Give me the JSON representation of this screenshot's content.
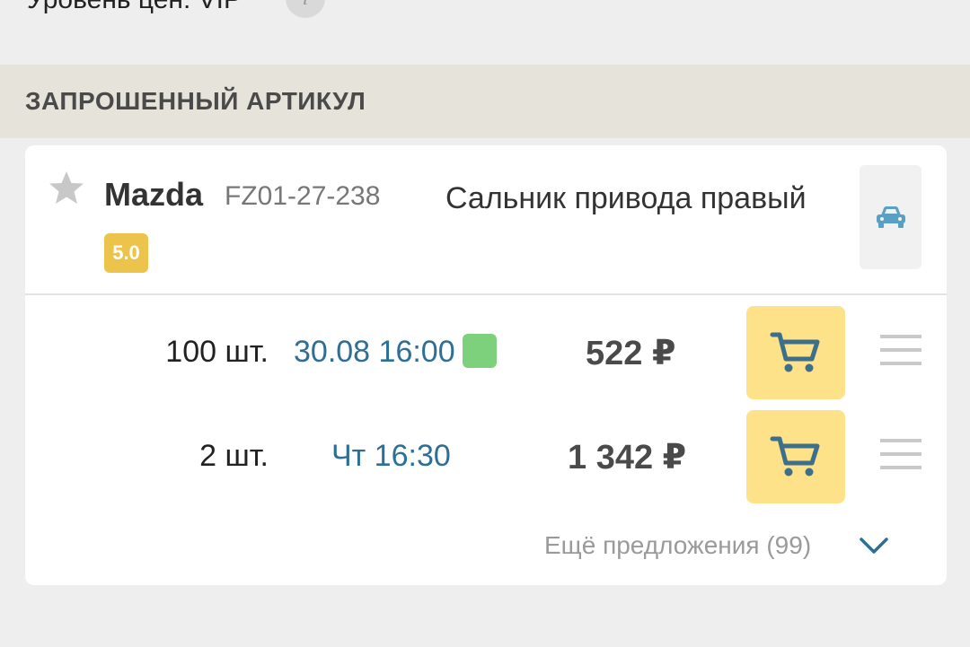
{
  "top": {
    "price_level_text": "Уровень цен: VIP",
    "info_icon": "info-icon",
    "info_glyph": "i"
  },
  "section": {
    "title": "ЗАПРОШЕННЫЙ АРТИКУЛ"
  },
  "product": {
    "brand": "Mazda",
    "article": "FZ01-27-238",
    "rating": "5.0",
    "description": "Сальник привода правый",
    "favorite_icon": "star-icon",
    "vehicle_icon": "car-icon"
  },
  "offers": [
    {
      "quantity": "100 шт.",
      "delivery": "30.08 16:00",
      "price": "522 ₽",
      "status_color": "#7dd07c",
      "cart_icon": "cart-icon",
      "menu_icon": "menu-icon"
    },
    {
      "quantity": "2 шт.",
      "delivery": "Чт 16:30",
      "price": "1 342 ₽",
      "cart_icon": "cart-icon",
      "menu_icon": "menu-icon"
    }
  ],
  "more_offers": {
    "label": "Ещё предложения (99)",
    "icon": "chevron-down-icon"
  },
  "colors": {
    "accent_blue": "#2e6f96",
    "cart_yellow": "#fde28a",
    "rating_yellow": "#ecc44c",
    "header_bg": "#e6e3db",
    "page_bg": "#eeeeee"
  }
}
